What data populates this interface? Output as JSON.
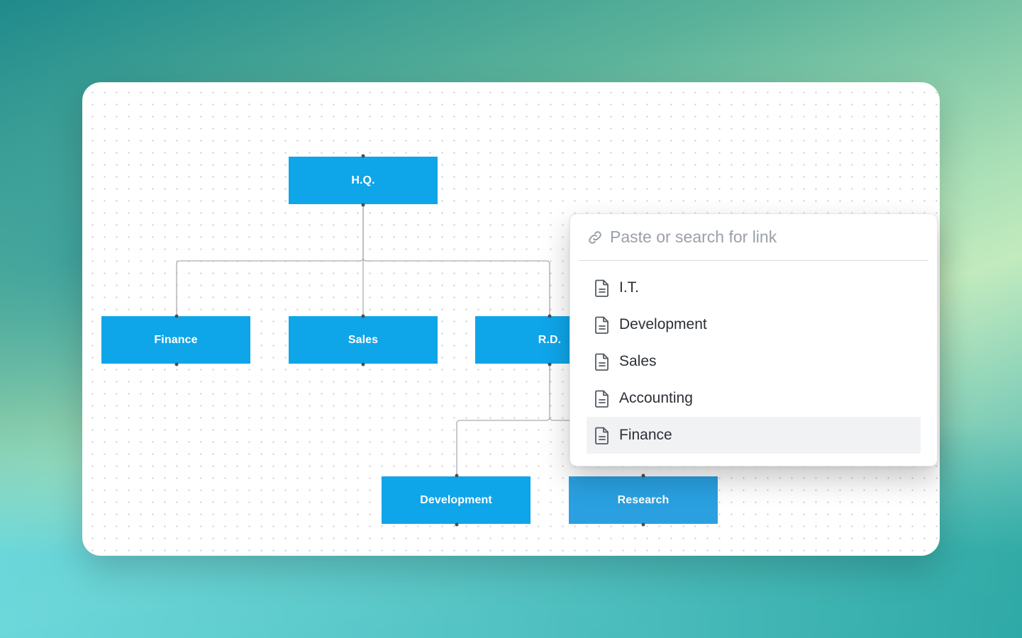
{
  "org_chart": {
    "nodes": {
      "hq": "H.Q.",
      "finance": "Finance",
      "sales": "Sales",
      "rd": "R.D.",
      "development": "Development",
      "research": "Research"
    }
  },
  "link_popover": {
    "search_placeholder": "Paste or search for link",
    "search_icon": "link-icon",
    "result_icon": "document-icon",
    "results": [
      {
        "label": "I.T.",
        "selected": false
      },
      {
        "label": "Development",
        "selected": false
      },
      {
        "label": "Sales",
        "selected": false
      },
      {
        "label": "Accounting",
        "selected": false
      },
      {
        "label": "Finance",
        "selected": true
      }
    ]
  },
  "colors": {
    "node_fill": "#0fa5e9",
    "selected_row": "#f1f2f4"
  }
}
